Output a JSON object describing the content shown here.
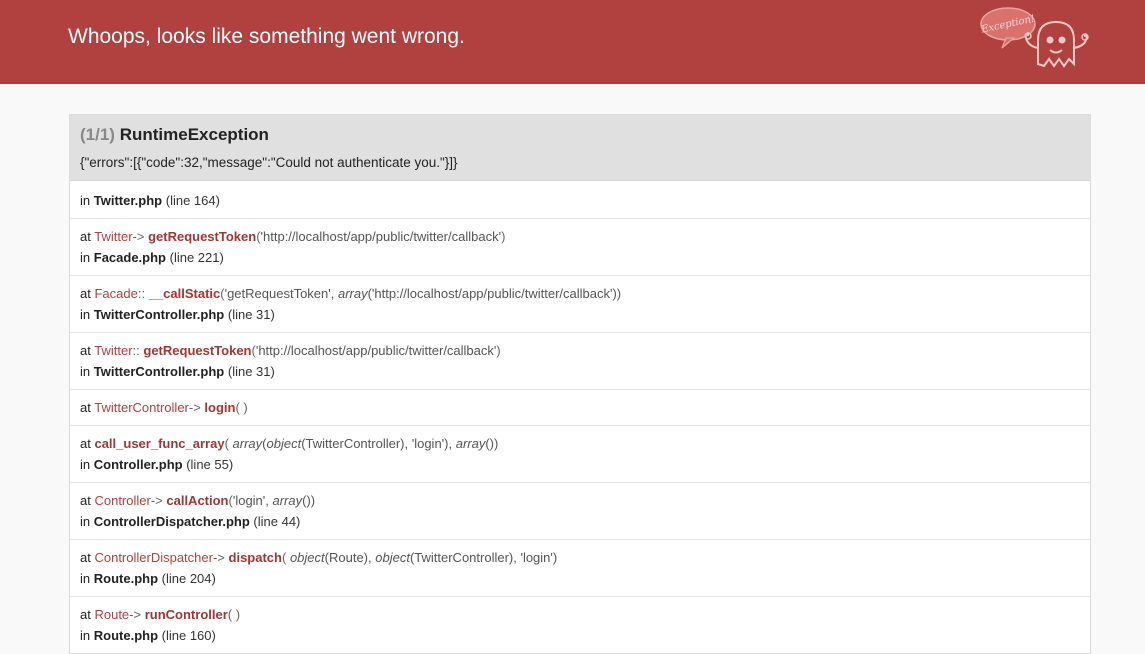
{
  "header": {
    "title": "Whoops, looks like something went wrong.",
    "logo_text": "Exception!"
  },
  "exception": {
    "count": "(1/1)",
    "name": "RuntimeException",
    "message": "{\"errors\":[{\"code\":32,\"message\":\"Could not authenticate you.\"}]}"
  },
  "frames": [
    {
      "in_prefix": "in",
      "file": "Twitter.php",
      "line": "(line 164)"
    },
    {
      "at": "at",
      "cls": "Twitter",
      "op": "->",
      "fn": "getRequestToken",
      "args_open": "(",
      "arg1": "'http://localhost/app/public/twitter/callback'",
      "args_close": ")",
      "in_prefix": "in",
      "file": "Facade.php",
      "line": "(line 221)"
    },
    {
      "at": "at",
      "cls": "Facade",
      "op": "::",
      "fn": "__callStatic",
      "args_open": "(",
      "arg1": "'getRequestToken', ",
      "arr": "array",
      "arg2": "('http://localhost/app/public/twitter/callback'))",
      "in_prefix": "in",
      "file": "TwitterController.php",
      "line": "(line 31)"
    },
    {
      "at": "at",
      "cls": "Twitter",
      "op": "::",
      "fn": "getRequestToken",
      "args_open": "(",
      "arg1": "'http://localhost/app/public/twitter/callback'",
      "args_close": ")",
      "in_prefix": "in",
      "file": "TwitterController.php",
      "line": "(line 31)"
    },
    {
      "at": "at",
      "cls": "TwitterController",
      "op": "->",
      "fn": "login",
      "args": "( )"
    },
    {
      "at": "at",
      "fn": "call_user_func_array",
      "args_open": "(",
      "arr1": "array",
      "p1": "(",
      "obj": "object",
      "p2": "(TwitterController), 'login'), ",
      "arr2": "array",
      "p3": "())",
      "in_prefix": "in",
      "file": "Controller.php",
      "line": "(line 55)"
    },
    {
      "at": "at",
      "cls": "Controller",
      "op": "->",
      "fn": "callAction",
      "args_open": "(",
      "arg1": "'login', ",
      "arr": "array",
      "arg2": "())",
      "in_prefix": "in",
      "file": "ControllerDispatcher.php",
      "line": "(line 44)"
    },
    {
      "at": "at",
      "cls": "ControllerDispatcher",
      "op": "->",
      "fn": "dispatch",
      "args_open": "(",
      "obj1": "object",
      "p1": "(Route), ",
      "obj2": "object",
      "p2": "(TwitterController), 'login')",
      "in_prefix": "in",
      "file": "Route.php",
      "line": "(line 204)"
    },
    {
      "at": "at",
      "cls": "Route",
      "op": "->",
      "fn": "runController",
      "args": "( )",
      "in_prefix": "in",
      "file": "Route.php",
      "line": "(line 160)"
    }
  ]
}
